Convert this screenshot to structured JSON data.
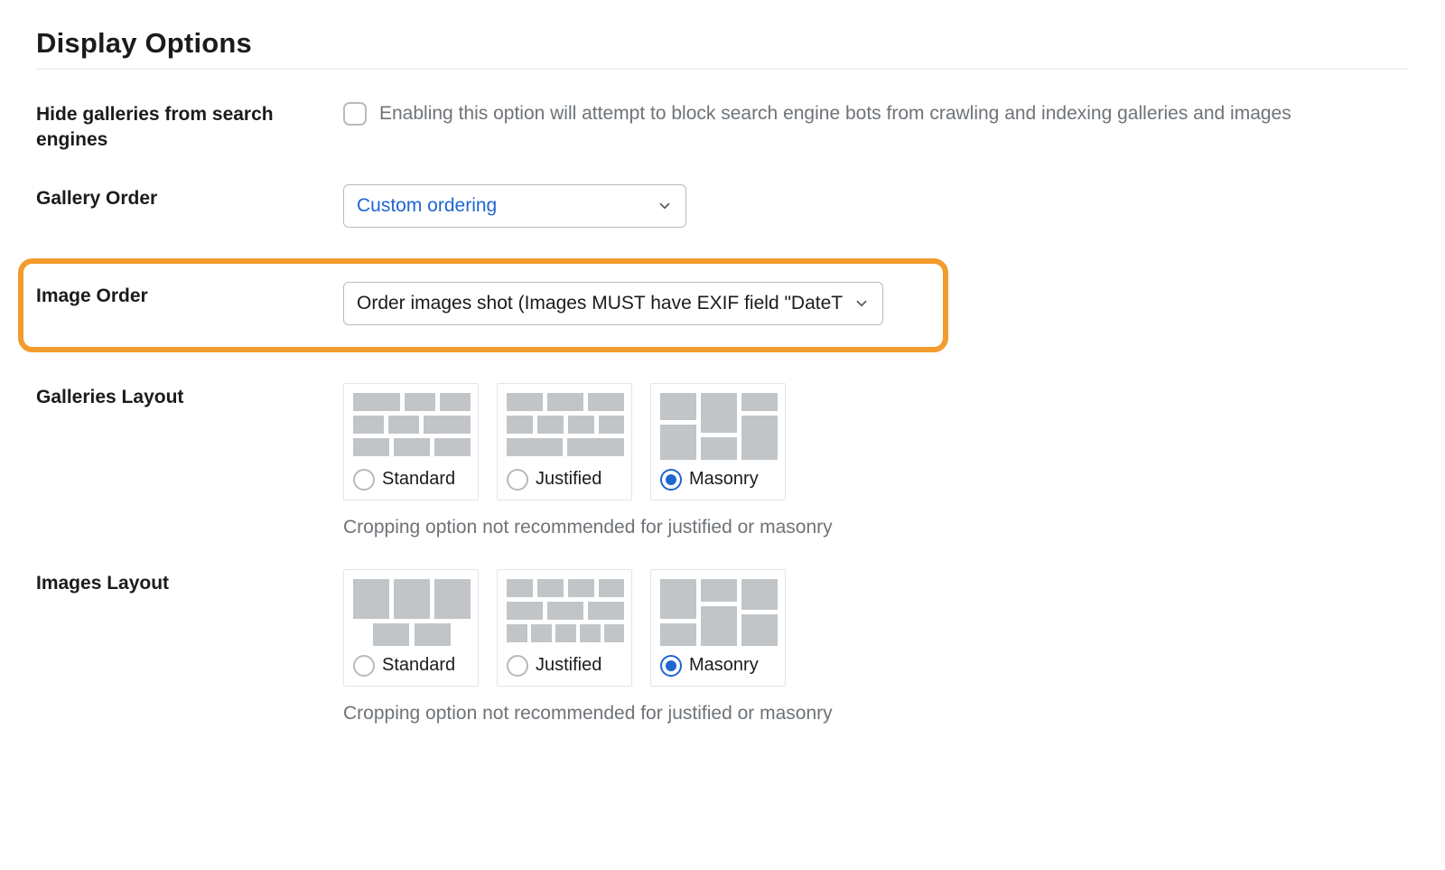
{
  "title": "Display Options",
  "hide_galleries": {
    "label": "Hide galleries from search engines",
    "checked": false,
    "description": "Enabling this option will attempt to block search engine bots from crawling and indexing galleries and images"
  },
  "gallery_order": {
    "label": "Gallery Order",
    "value": "Custom ordering"
  },
  "image_order": {
    "label": "Image Order",
    "value": "Order images shot (Images MUST have EXIF field \"DateT"
  },
  "galleries_layout": {
    "label": "Galleries Layout",
    "options": [
      {
        "name": "Standard",
        "selected": false
      },
      {
        "name": "Justified",
        "selected": false
      },
      {
        "name": "Masonry",
        "selected": true
      }
    ],
    "hint": "Cropping option not recommended for justified or masonry"
  },
  "images_layout": {
    "label": "Images Layout",
    "options": [
      {
        "name": "Standard",
        "selected": false
      },
      {
        "name": "Justified",
        "selected": false
      },
      {
        "name": "Masonry",
        "selected": true
      }
    ],
    "hint": "Cropping option not recommended for justified or masonry"
  },
  "colors": {
    "accent_blue": "#1e66d0",
    "highlight_orange": "#f29b2e"
  }
}
